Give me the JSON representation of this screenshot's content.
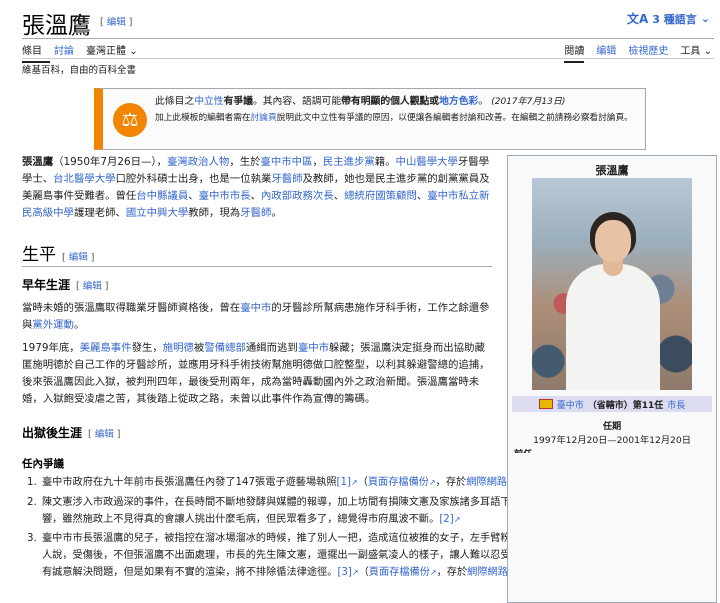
{
  "header": {
    "title": "張溫鷹",
    "title_edit": "编辑",
    "languages": "3 種語言",
    "languages_icon": "translate-icon"
  },
  "tabs": {
    "article": "條目",
    "talk": "討論",
    "variant": "臺灣正體",
    "read": "閱讀",
    "edit": "编辑",
    "history": "檢視歷史",
    "tools": "工具"
  },
  "tagline": "維基百科，自由的百科全書",
  "notice": {
    "icon": "scales-icon",
    "line1_a": "此條目之",
    "line1_link1": "中立性",
    "line1_b": "有爭議",
    "line1_c": "。其內容、語調可能",
    "line1_bold": "帶有明顯的個人觀點或",
    "line1_link2": "地方色彩",
    "line1_d": "。",
    "date": "(2017年7月13日)",
    "line2_a": "加上此模板的編輯者需在",
    "line2_link": "討論頁",
    "line2_b": "說明此文中立性有爭議的原因，以便讓各編輯者討論和改善。在編輯之前請務必察看討論頁。"
  },
  "intro": {
    "name": "張溫鷹",
    "t1": "（1950年7月26日—），",
    "l1": "臺灣政治人物",
    "t2": "，生於",
    "l2": "臺中市中區",
    "t3": "，",
    "l3": "民主進步黨",
    "t4": "籍。",
    "l4": "中山醫學大學",
    "t5": "牙醫學學士、",
    "l5": "台北醫學大學",
    "t6": "口腔外科碩士出身，也是一位執業",
    "l6": "牙醫師",
    "t7": "及教師，她也是民主進步黨的創黨黨員及美麗島事件受難者。曾任",
    "l7": "台中縣議員",
    "t8": "、",
    "l8": "臺中市市長",
    "t9": "、",
    "l9": "內政部政務次長",
    "t10": "、",
    "l10": "總統府國策顧問",
    "t11": "、",
    "l11": "臺中市私立新民高級中學",
    "t12": "護理老師、",
    "l12": "國立中興大學",
    "t13": "教師，現為",
    "l13": "牙醫師",
    "t14": "。"
  },
  "sections": {
    "life": "生平",
    "early": "早年生涯",
    "early_p1_a": "當時未婚的張溫鷹取得職業牙醫師資格後，曾在",
    "early_p1_l1": "臺中市",
    "early_p1_b": "的牙醫診所幫病患施作牙科手術，工作之餘還參與",
    "early_p1_l2": "黨外運動",
    "early_p1_c": "。",
    "early_p2_a": "1979年底，",
    "early_p2_l1": "美麗島事件",
    "early_p2_b": "發生，",
    "early_p2_l2": "施明德",
    "early_p2_c": "被",
    "early_p2_l3": "警備總部",
    "early_p2_d": "通緝而逃到",
    "early_p2_l4": "臺中市",
    "early_p2_e": "躲藏；張溫鷹決定挺身而出協助藏匿施明德於自己工作的牙醫診所，並應用牙科手術技術幫施明德做口腔整型，以利其躲避警總的追捕，後來張溫鷹因此入獄，被判刑四年，最後受刑兩年，成為當時轟動國內外之政治新聞。張溫鷹當時未婚，入獄飽受凌虐之苦，其後踏上從政之路，未曾以此事件作為宣傳的籌碼。",
    "after": "出獄後生涯",
    "term": "任內爭議",
    "edit": "编辑"
  },
  "controversies": [
    {
      "num": "1.",
      "a": "臺中市政府在九十年前市長張溫鷹任內發了147張電子遊藝場執照",
      "ref": "[1]",
      "b": "（",
      "l1": "頁面存檔備份",
      "c": "，存於",
      "l2": "網際網路檔案館",
      "d": "）。"
    },
    {
      "num": "2.",
      "a": "陳文憲涉入市政過深的事件，在長時間不斷地發酵與媒體的報導，加上坊間有損陳文憲及家族諸多耳語下，久而久之自然對張溫鷹夫婦產生不利的影響，雖然施政上不見得真的會讓人挑出什麼毛病，但民眾看多了，總覺得市府風波不斷。",
      "ref": "[2]"
    },
    {
      "num": "3.",
      "a": "臺中市市長張溫鷹的兒子，被指控在溜冰場溜冰的時候，推了別人一把，造成這位被推的女子，左手臂粉碎骨折，還有殘廢的可能，這名女子和他的家人說，受傷後，不但張溫鷹不出面處理，市長的先生陳文憲，還擺出一副盛氣凌人的樣子，讓人難以忍受，才上法院控告。不過陳文憲表示，他們絕對有誠意解決問題，但是如果有不實的渲染，將不排除循法律途徑。",
      "ref": "[3]",
      "b": "（",
      "l1": "頁面存檔備份",
      "c": "，存於",
      "l2": "網際網路檔案館",
      "d": "）"
    }
  ],
  "infobox": {
    "title": "張溫鷹",
    "photo_icon": "portrait-photo",
    "office_link": "臺中市",
    "office_paren": "（省轄市）第11任",
    "office_link2": "市長",
    "term_label": "任期",
    "term_value": "1997年12月20日—2001年12月20日",
    "cut_text": "前任"
  }
}
